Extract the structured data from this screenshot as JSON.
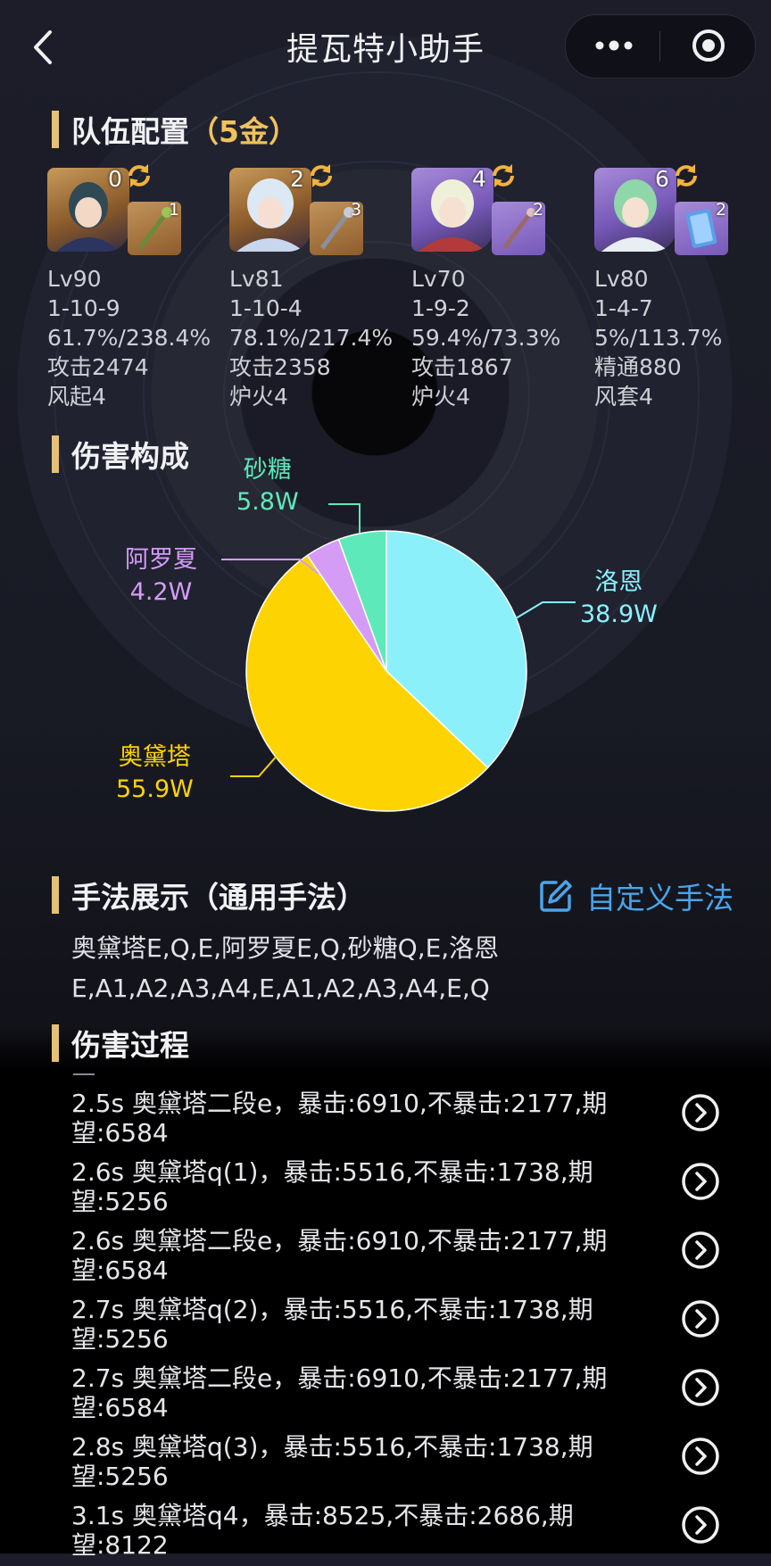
{
  "navbar": {
    "title": "提瓦特小助手",
    "back_icon": "chevron-left-icon",
    "more_icon": "more-dots-icon",
    "close_icon": "target-circle-icon"
  },
  "team": {
    "title": "队伍配置",
    "rarity": "（5金）",
    "members": [
      {
        "constellation": "0",
        "refine": "1",
        "level": "Lv90",
        "talents": "1-10-9",
        "crit": "61.7%/238.4%",
        "main_stat": "攻击2474",
        "artifact": "风起4"
      },
      {
        "constellation": "2",
        "refine": "3",
        "level": "Lv81",
        "talents": "1-10-4",
        "crit": "78.1%/217.4%",
        "main_stat": "攻击2358",
        "artifact": "炉火4"
      },
      {
        "constellation": "4",
        "refine": "2",
        "level": "Lv70",
        "talents": "1-9-2",
        "crit": "59.4%/73.3%",
        "main_stat": "攻击1867",
        "artifact": "炉火4"
      },
      {
        "constellation": "6",
        "refine": "2",
        "level": "Lv80",
        "talents": "1-4-7",
        "crit": "5%/113.7%",
        "main_stat": "精通880",
        "artifact": "风套4"
      }
    ]
  },
  "damage": {
    "title": "伤害构成"
  },
  "chart_data": {
    "type": "pie",
    "unit": "W",
    "slices": [
      {
        "name": "洛恩",
        "value": 38.9,
        "label": "38.9W",
        "color": "#8cf0fa"
      },
      {
        "name": "奥黛塔",
        "value": 55.9,
        "label": "55.9W",
        "color": "#fdd402"
      },
      {
        "name": "阿罗夏",
        "value": 4.2,
        "label": "4.2W",
        "color": "#d59cf6"
      },
      {
        "name": "砂糖",
        "value": 5.8,
        "label": "5.8W",
        "color": "#5ee9ba"
      }
    ]
  },
  "technique": {
    "title": "手法展示（通用手法）",
    "custom_label": "自定义手法",
    "sequence": "奥黛塔E,Q,E,阿罗夏E,Q,砂糖Q,E,洛恩E,A1,A2,A3,A4,E,A1,A2,A3,A4,E,Q"
  },
  "process": {
    "title": "伤害过程",
    "items": [
      "2.5s 奥黛塔二段e，暴击:6910,不暴击:2177,期望:6584",
      "2.6s 奥黛塔q(1)，暴击:5516,不暴击:1738,期望:5256",
      "2.6s 奥黛塔二段e，暴击:6910,不暴击:2177,期望:6584",
      "2.7s 奥黛塔q(2)，暴击:5516,不暴击:1738,期望:5256",
      "2.7s 奥黛塔二段e，暴击:6910,不暴击:2177,期望:6584",
      "2.8s 奥黛塔q(3)，暴击:5516,不暴击:1738,期望:5256",
      "3.1s 奥黛塔q4，暴击:8525,不暴击:2686,期望:8122"
    ]
  }
}
